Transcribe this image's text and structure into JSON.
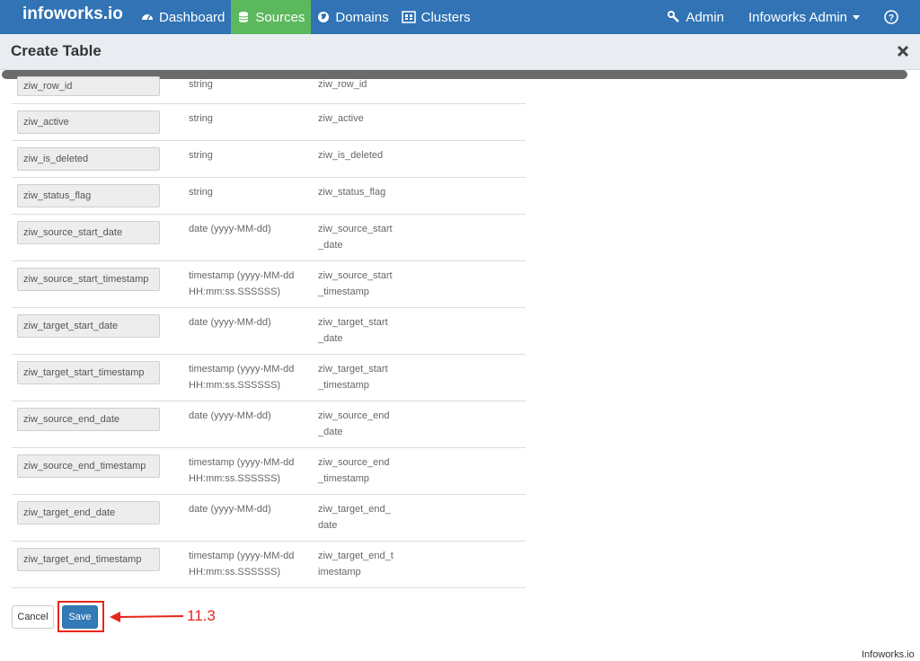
{
  "navbar": {
    "brand": "infoworks.io",
    "items": [
      {
        "label": "Dashboard",
        "icon": "dashboard-icon"
      },
      {
        "label": "Sources",
        "icon": "database-icon",
        "active": true
      },
      {
        "label": "Domains",
        "icon": "globe-icon"
      },
      {
        "label": "Clusters",
        "icon": "clusters-icon"
      }
    ],
    "admin_label": "Admin",
    "user_label": "Infoworks Admin",
    "help_icon": "help-icon"
  },
  "modal": {
    "title": "Create Table"
  },
  "rows": [
    {
      "field": "ziw_row_id",
      "type": "string",
      "target": "ziw_row_id"
    },
    {
      "field": "ziw_active",
      "type": "string",
      "target": "ziw_active"
    },
    {
      "field": "ziw_is_deleted",
      "type": "string",
      "target": "ziw_is_deleted"
    },
    {
      "field": "ziw_status_flag",
      "type": "string",
      "target": "ziw_status_flag"
    },
    {
      "field": "ziw_source_start_date",
      "type": "date (yyyy-MM-dd)",
      "target": "ziw_source_start\n_date"
    },
    {
      "field": "ziw_source_start_timestamp",
      "type": "timestamp (yyyy-MM-dd\nHH:mm:ss.SSSSSS)",
      "target": "ziw_source_start\n_timestamp"
    },
    {
      "field": "ziw_target_start_date",
      "type": "date (yyyy-MM-dd)",
      "target": "ziw_target_start\n_date"
    },
    {
      "field": "ziw_target_start_timestamp",
      "type": "timestamp (yyyy-MM-dd\nHH:mm:ss.SSSSSS)",
      "target": "ziw_target_start\n_timestamp"
    },
    {
      "field": "ziw_source_end_date",
      "type": "date (yyyy-MM-dd)",
      "target": "ziw_source_end\n_date"
    },
    {
      "field": "ziw_source_end_timestamp",
      "type": "timestamp (yyyy-MM-dd\nHH:mm:ss.SSSSSS)",
      "target": "ziw_source_end\n_timestamp"
    },
    {
      "field": "ziw_target_end_date",
      "type": "date (yyyy-MM-dd)",
      "target": "ziw_target_end_\ndate"
    },
    {
      "field": "ziw_target_end_timestamp",
      "type": "timestamp (yyyy-MM-dd\nHH:mm:ss.SSSSSS)",
      "target": "ziw_target_end_t\nimestamp"
    }
  ],
  "buttons": {
    "cancel": "Cancel",
    "save": "Save"
  },
  "annotation": {
    "label": "11.3",
    "color": "#e8261b"
  },
  "footer": {
    "brand": "Infoworks.io"
  },
  "colors": {
    "navbar": "#3173b5",
    "active_tab": "#5cb85c",
    "save_button": "#337ab7"
  }
}
